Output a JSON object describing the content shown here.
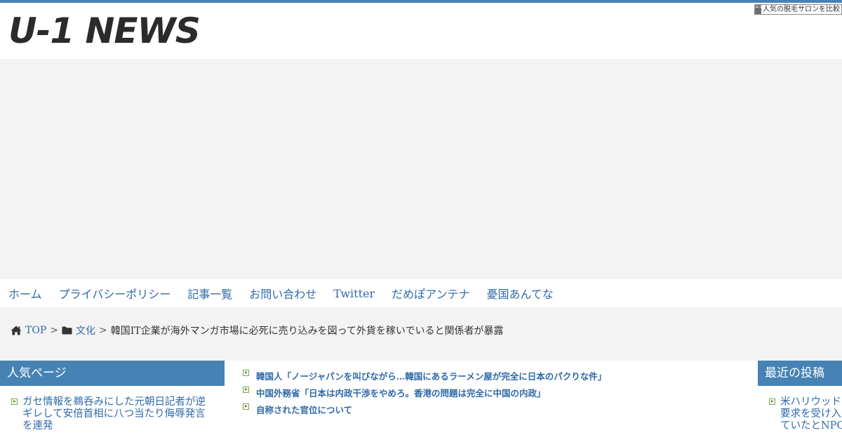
{
  "site": {
    "logo": "U-1 NEWS",
    "ad_label": "人気の脱毛サロンを比較",
    "ad_icon_text": "広告",
    "accent_color": "#4682b4",
    "link_color": "#2f6aa8"
  },
  "nav": {
    "items": [
      {
        "label": "ホーム"
      },
      {
        "label": "プライバシーポリシー"
      },
      {
        "label": "記事一覧"
      },
      {
        "label": "お問い合わせ"
      },
      {
        "label": "Twitter"
      },
      {
        "label": "だめぽアンテナ"
      },
      {
        "label": "憂国あんてな"
      }
    ]
  },
  "breadcrumb": {
    "home_icon": "home-icon",
    "home_label": "TOP",
    "separator": ">",
    "category_icon": "folder-icon",
    "category_label": "文化",
    "current": "韓国IT企業が海外マンガ市場に必死に売り込みを図って外貨を稼いでいると関係者が暴露"
  },
  "sidebar_left": {
    "title": "人気ページ",
    "items": [
      {
        "title": "ガセ情報を鵜呑みにした元朝日記者が逆ギレして安倍首相に八つ当たり侮辱発言を連発"
      }
    ]
  },
  "main": {
    "related_links": [
      {
        "title": "韓国人「ノージャパンを叫びながら…韓国にあるラーメン屋が完全に日本のパクりな件」"
      },
      {
        "title": "中国外務省「日本は内政干渉をやめろ。香港の問題は完全に中国の内政」"
      },
      {
        "title": "自称された官位について"
      }
    ]
  },
  "sidebar_right": {
    "title": "最近の投稿",
    "items": [
      {
        "title": "米ハリウッドが出した屈辱的要求を受け入れて墓穴を掘っていたとNPO団体"
      }
    ]
  }
}
